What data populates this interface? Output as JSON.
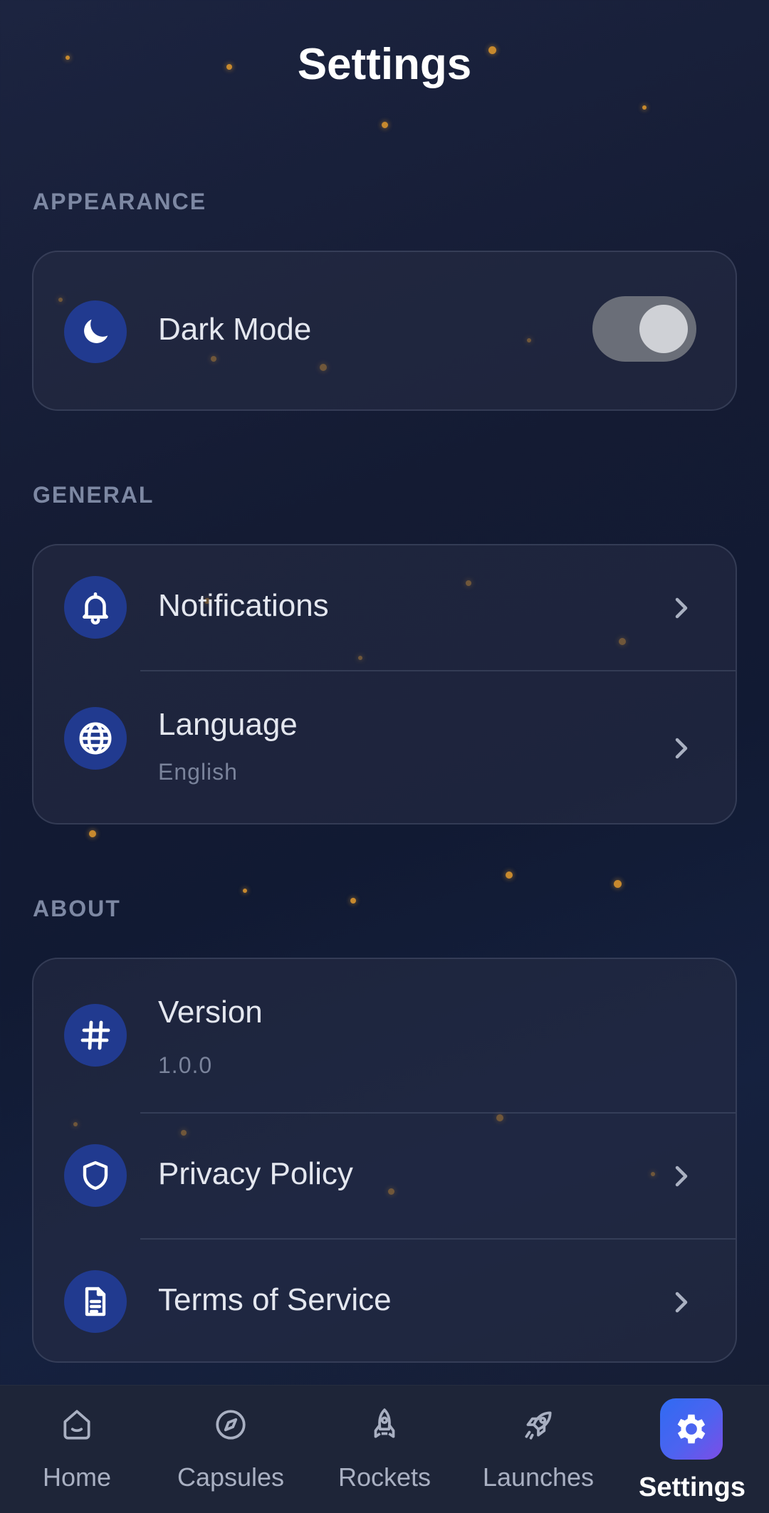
{
  "header": {
    "title": "Settings"
  },
  "sections": {
    "appearance": {
      "label": "APPEARANCE",
      "dark_mode": {
        "label": "Dark Mode",
        "icon": "moon-icon",
        "enabled": true
      }
    },
    "general": {
      "label": "GENERAL",
      "notifications": {
        "label": "Notifications",
        "icon": "bell-icon"
      },
      "language": {
        "label": "Language",
        "value": "English",
        "icon": "globe-icon"
      }
    },
    "about": {
      "label": "ABOUT",
      "version": {
        "label": "Version",
        "value": "1.0.0",
        "icon": "hash-icon"
      },
      "privacy": {
        "label": "Privacy Policy",
        "icon": "shield-icon"
      },
      "terms": {
        "label": "Terms of Service",
        "icon": "document-icon"
      }
    }
  },
  "nav": {
    "home": {
      "label": "Home",
      "icon": "home-icon"
    },
    "capsules": {
      "label": "Capsules",
      "icon": "compass-icon"
    },
    "rockets": {
      "label": "Rockets",
      "icon": "rocket-icon"
    },
    "launches": {
      "label": "Launches",
      "icon": "launch-rocket-icon"
    },
    "settings": {
      "label": "Settings",
      "icon": "gear-icon",
      "active": true
    }
  },
  "colors": {
    "background": "#141b33",
    "icon_circle": "#213a8f",
    "accent_gradient_start": "#2f6bf2",
    "accent_gradient_end": "#7d4de6",
    "star": "#c7892e"
  }
}
